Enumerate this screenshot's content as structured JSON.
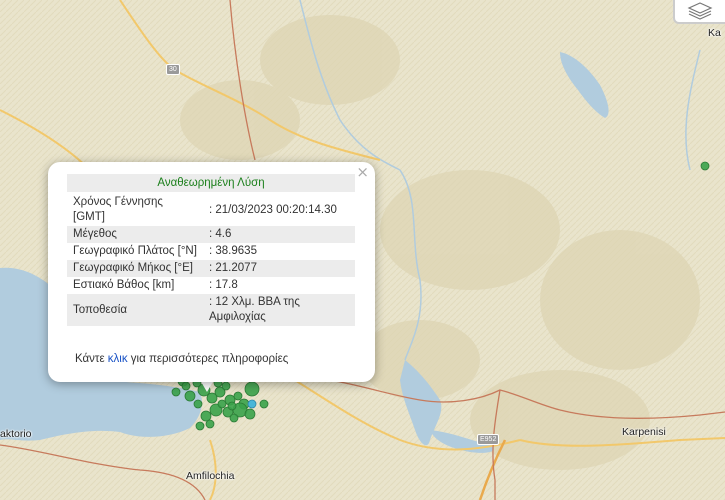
{
  "map": {
    "labels": {
      "amfilochia": "Amfilochia",
      "karpenisi": "Karpenisi",
      "aktorio": "aktorio",
      "corner": "Ka"
    },
    "road_shields": {
      "r30": "30",
      "e952": "E952"
    },
    "colors": {
      "terrain": "#e9e4cc",
      "water": "#b1ccde",
      "road": "#f2c86b",
      "border": "#c77a5c",
      "marker_green": "#3aa24a",
      "marker_blue": "#49b6d8"
    }
  },
  "layers_control": {
    "icon": "layers-icon"
  },
  "popup": {
    "close": "×",
    "title": "Αναθεωρημένη Λύση",
    "rows": [
      {
        "label": "Χρόνος Γέννησης [GMT]",
        "value": ": 21/03/2023 00:20:14.30"
      },
      {
        "label": "Μέγεθος",
        "value": ": 4.6"
      },
      {
        "label": "Γεωγραφικό Πλάτος [°N]",
        "value": ": 38.9635"
      },
      {
        "label": "Γεωγραφικό Μήκος [°E]",
        "value": ": 21.2077"
      },
      {
        "label": "Εστιακό Βάθος [km]",
        "value": ": 17.8"
      },
      {
        "label": "Τοποθεσία",
        "value": ": 12 Χλμ. ΒΒΑ της Αμφιλοχίας"
      }
    ],
    "more_prefix": "Κάντε ",
    "more_link": "κλικ",
    "more_suffix": " για περισσότερες πληροφορίες"
  }
}
